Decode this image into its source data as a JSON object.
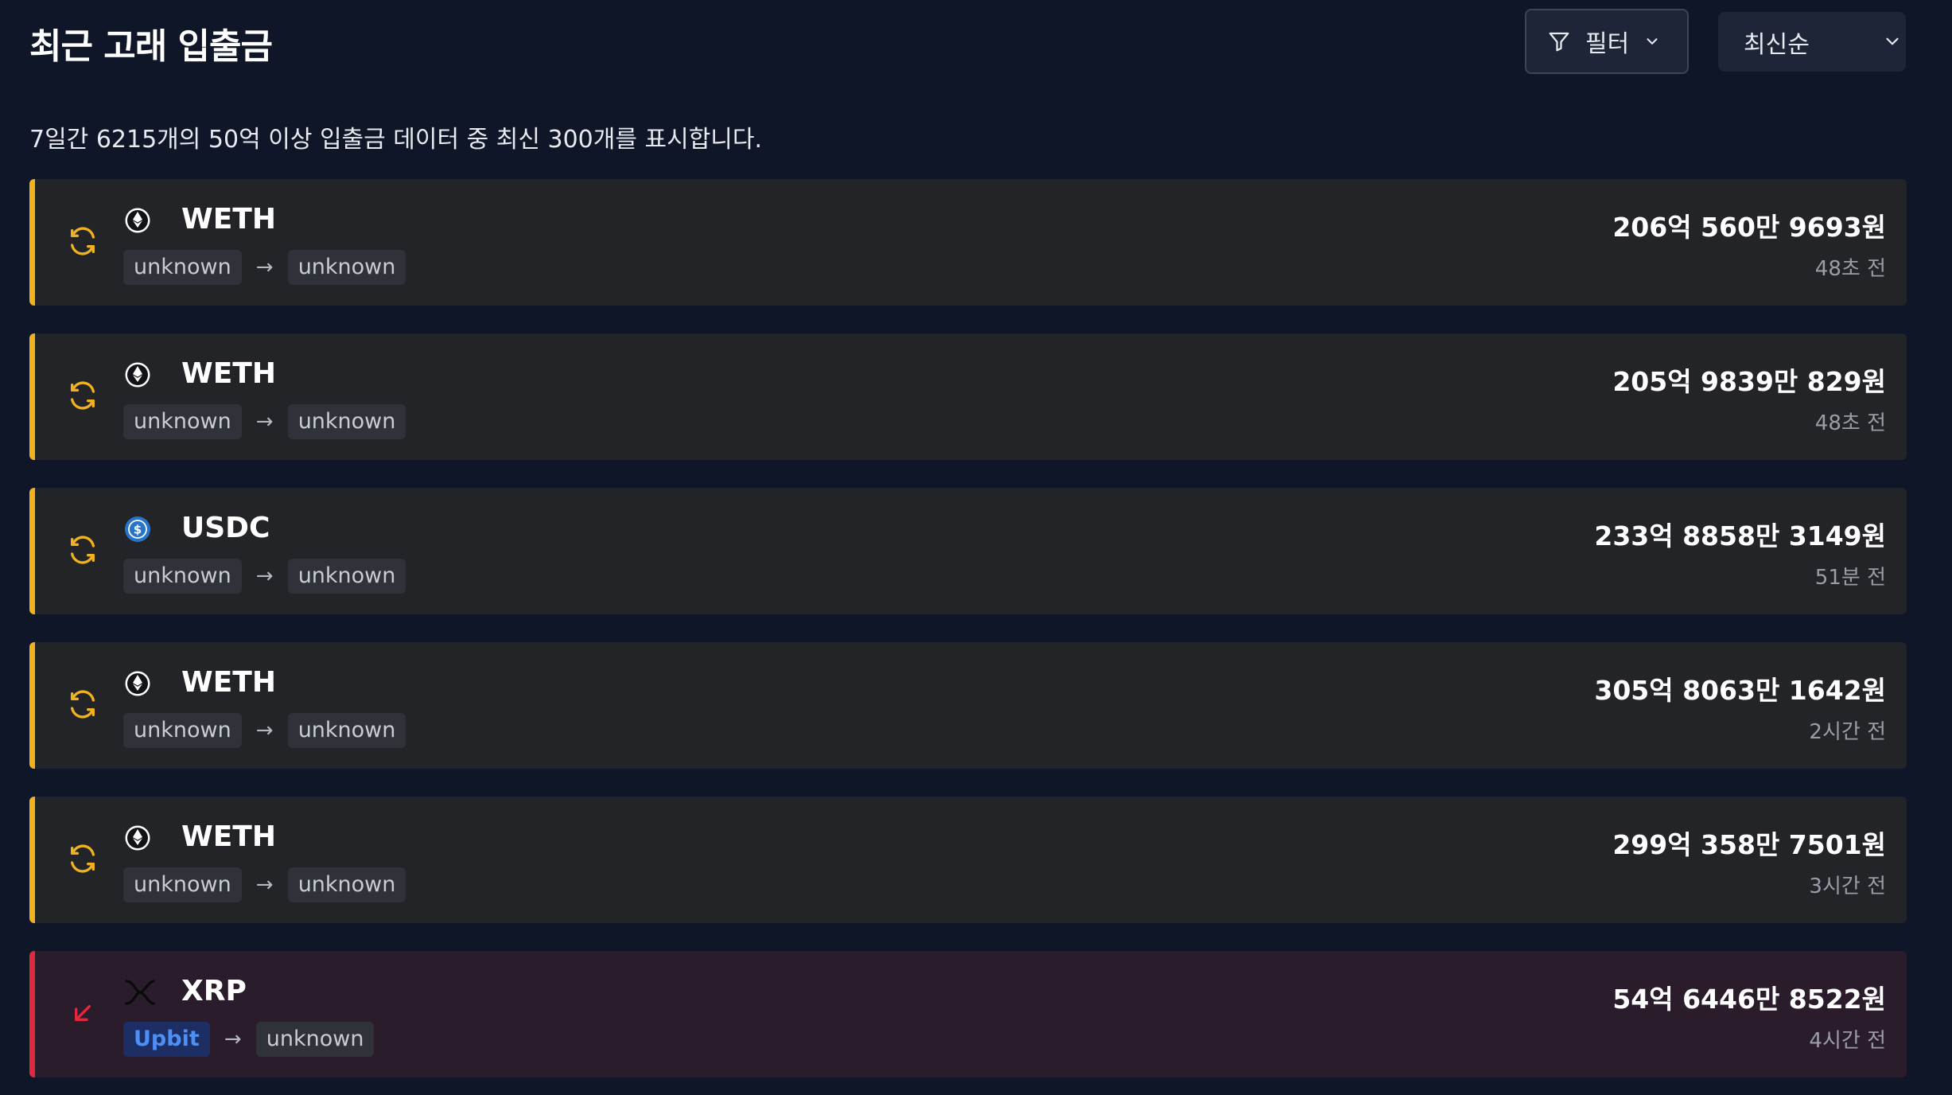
{
  "header": {
    "title": "최근 고래 입출금",
    "filter_label": "필터",
    "sort_label": "최신순"
  },
  "summary": "7일간 6215개의 50억 이상 입출금 데이터 중 최신 300개를 표시합니다.",
  "colors": {
    "background": "#0f1628",
    "transfer_accent": "#f2b21e",
    "outflow_accent": "#e0293e",
    "exchange_tag_text": "#4d8ef7"
  },
  "transactions": [
    {
      "type": "transfer",
      "type_icon": "swap-icon",
      "token": "WETH",
      "token_icon": "ethereum-icon",
      "from": "unknown",
      "arrow": "→",
      "to": "unknown",
      "amount": "206억 560만 9693원",
      "time": "48초 전"
    },
    {
      "type": "transfer",
      "type_icon": "swap-icon",
      "token": "WETH",
      "token_icon": "ethereum-icon",
      "from": "unknown",
      "arrow": "→",
      "to": "unknown",
      "amount": "205억 9839만 829원",
      "time": "48초 전"
    },
    {
      "type": "transfer",
      "type_icon": "swap-icon",
      "token": "USDC",
      "token_icon": "usdc-icon",
      "from": "unknown",
      "arrow": "→",
      "to": "unknown",
      "amount": "233억 8858만 3149원",
      "time": "51분 전"
    },
    {
      "type": "transfer",
      "type_icon": "swap-icon",
      "token": "WETH",
      "token_icon": "ethereum-icon",
      "from": "unknown",
      "arrow": "→",
      "to": "unknown",
      "amount": "305억 8063만 1642원",
      "time": "2시간 전"
    },
    {
      "type": "transfer",
      "type_icon": "swap-icon",
      "token": "WETH",
      "token_icon": "ethereum-icon",
      "from": "unknown",
      "arrow": "→",
      "to": "unknown",
      "amount": "299억 358만 7501원",
      "time": "3시간 전"
    },
    {
      "type": "outflow",
      "type_icon": "arrow-down-left-icon",
      "token": "XRP",
      "token_icon": "xrp-icon",
      "from": "Upbit",
      "arrow": "→",
      "to": "unknown",
      "amount": "54억 6446만 8522원",
      "time": "4시간 전"
    }
  ]
}
